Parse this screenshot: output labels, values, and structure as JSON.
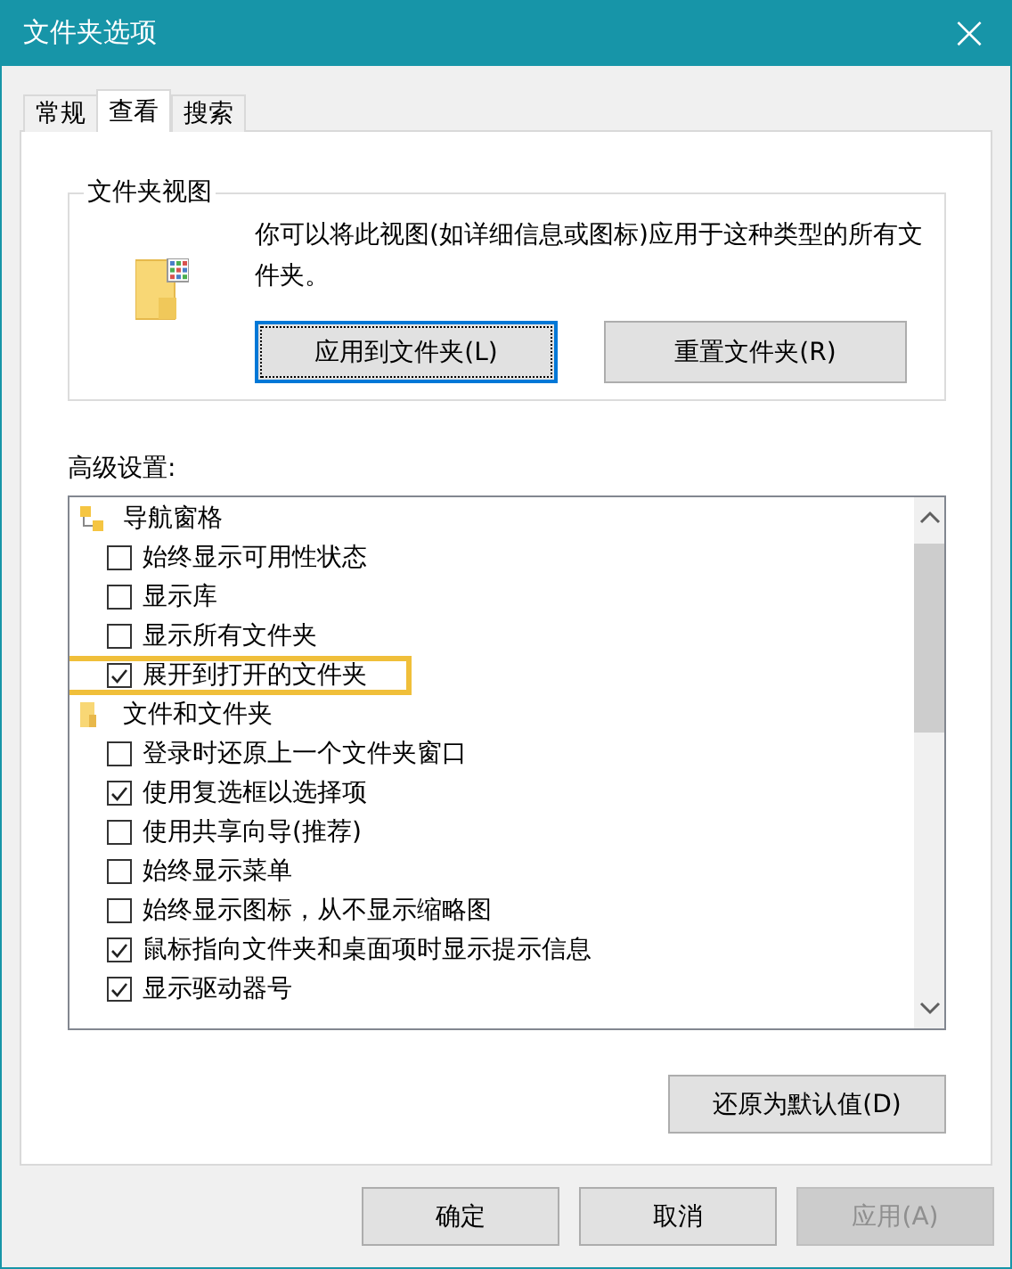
{
  "window": {
    "title": "文件夹选项",
    "close": "×"
  },
  "tabs": [
    {
      "label": "常规",
      "selected": false
    },
    {
      "label": "查看",
      "selected": true
    },
    {
      "label": "搜索",
      "selected": false
    }
  ],
  "folder_views": {
    "title": "文件夹视图",
    "description": "你可以将此视图(如详细信息或图标)应用于这种类型的所有文件夹。",
    "buttons": [
      {
        "label": "应用到文件夹(L)",
        "focused": true
      },
      {
        "label": "重置文件夹(R)",
        "focused": false
      }
    ]
  },
  "advanced": {
    "label": "高级设置:",
    "groups": [
      {
        "kind": "navigation",
        "label": "导航窗格",
        "children": [
          {
            "label": "始终显示可用性状态",
            "checked": false,
            "highlighted": false
          },
          {
            "label": "显示库",
            "checked": false,
            "highlighted": false
          },
          {
            "label": "显示所有文件夹",
            "checked": false,
            "highlighted": false
          },
          {
            "label": "展开到打开的文件夹",
            "checked": true,
            "highlighted": true
          }
        ]
      },
      {
        "kind": "folder",
        "label": "文件和文件夹",
        "children": [
          {
            "label": "登录时还原上一个文件夹窗口",
            "checked": false,
            "highlighted": false
          },
          {
            "label": "使用复选框以选择项",
            "checked": true,
            "highlighted": false
          },
          {
            "label": "使用共享向导(推荐)",
            "checked": false,
            "highlighted": false
          },
          {
            "label": "始终显示菜单",
            "checked": false,
            "highlighted": false
          },
          {
            "label": "始终显示图标，从不显示缩略图",
            "checked": false,
            "highlighted": false
          },
          {
            "label": "鼠标指向文件夹和桌面项时显示提示信息",
            "checked": true,
            "highlighted": false
          },
          {
            "label": "显示驱动器号",
            "checked": true,
            "highlighted": false
          }
        ]
      }
    ],
    "restore_button": "还原为默认值(D)"
  },
  "footer_buttons": [
    {
      "label": "确定",
      "disabled": false
    },
    {
      "label": "取消",
      "disabled": false
    },
    {
      "label": "应用(A)",
      "disabled": true
    }
  ]
}
